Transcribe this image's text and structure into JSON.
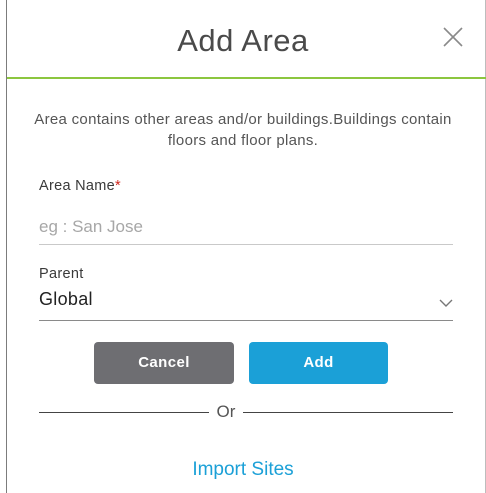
{
  "dialog": {
    "title": "Add Area",
    "description": "Area contains other areas and/or buildings.Buildings contain floors and floor plans."
  },
  "form": {
    "area_name_label": "Area Name",
    "required_marker": "*",
    "area_name_placeholder": "eg : San Jose",
    "area_name_value": "",
    "parent_label": "Parent",
    "parent_value": "Global"
  },
  "buttons": {
    "cancel": "Cancel",
    "add": "Add"
  },
  "divider": {
    "text": "Or"
  },
  "import_link": "Import Sites",
  "icons": {
    "close": "close-icon",
    "dropdown": "chevron-down-icon"
  },
  "colors": {
    "accent_green": "#8cc63f",
    "primary_blue": "#1ba0d7",
    "cancel_gray": "#6e6e72",
    "required_red": "#d0271d"
  }
}
